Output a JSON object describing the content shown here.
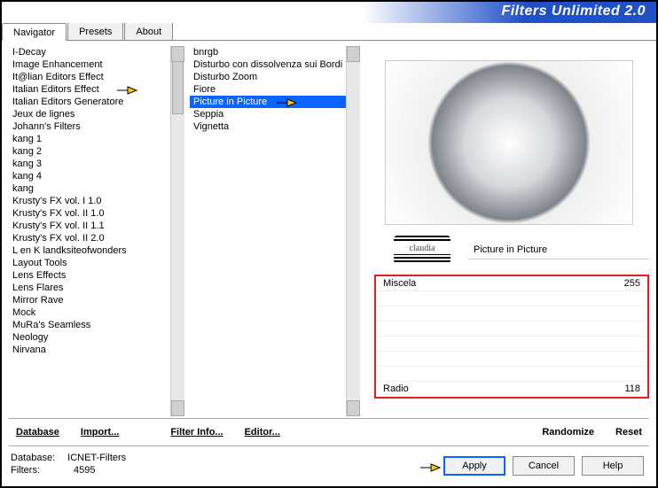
{
  "app": {
    "title": "Filters Unlimited 2.0"
  },
  "tabs": [
    {
      "label": "Navigator",
      "active": true
    },
    {
      "label": "Presets",
      "active": false
    },
    {
      "label": "About",
      "active": false
    }
  ],
  "categories": {
    "items": [
      "I-Decay",
      "Image Enhancement",
      "It@lian Editors Effect",
      "Italian Editors Effect",
      "Italian Editors Generatore",
      "Jeux de lignes",
      "Johann's Filters",
      "kang 1",
      "kang 2",
      "kang 3",
      "kang 4",
      "kang",
      "Krusty's FX vol. I 1.0",
      "Krusty's FX vol. II 1.0",
      "Krusty's FX vol. II 1.1",
      "Krusty's FX vol. II 2.0",
      "L en K landksiteofwonders",
      "Layout Tools",
      "Lens Effects",
      "Lens Flares",
      "Mirror Rave",
      "Mock",
      "MuRa's Seamless",
      "Neology",
      "Nirvana"
    ],
    "pointed_index": 3
  },
  "filters": {
    "items": [
      "bnrgb",
      "Disturbo con dissolvenza sui Bordi",
      "Disturbo Zoom",
      "Fiore",
      "Picture in Picture",
      "Seppia",
      "Vignetta"
    ],
    "selected_index": 4,
    "pointed_index": 4
  },
  "current_filter": {
    "name": "Picture in Picture"
  },
  "params": {
    "rows": [
      {
        "label": "Miscela",
        "value": "255"
      },
      {
        "label": "",
        "value": ""
      },
      {
        "label": "",
        "value": ""
      },
      {
        "label": "",
        "value": ""
      },
      {
        "label": "",
        "value": ""
      },
      {
        "label": "",
        "value": ""
      },
      {
        "label": "",
        "value": ""
      },
      {
        "label": "Radio",
        "value": "118"
      }
    ]
  },
  "toolbar": {
    "database": "Database",
    "import": "Import...",
    "filter_info": "Filter Info...",
    "editor": "Editor...",
    "randomize": "Randomize",
    "reset": "Reset"
  },
  "status": {
    "db_label": "Database:",
    "db_value": "ICNET-Filters",
    "filters_label": "Filters:",
    "filters_value": "4595"
  },
  "buttons": {
    "apply": "Apply",
    "cancel": "Cancel",
    "help": "Help"
  }
}
